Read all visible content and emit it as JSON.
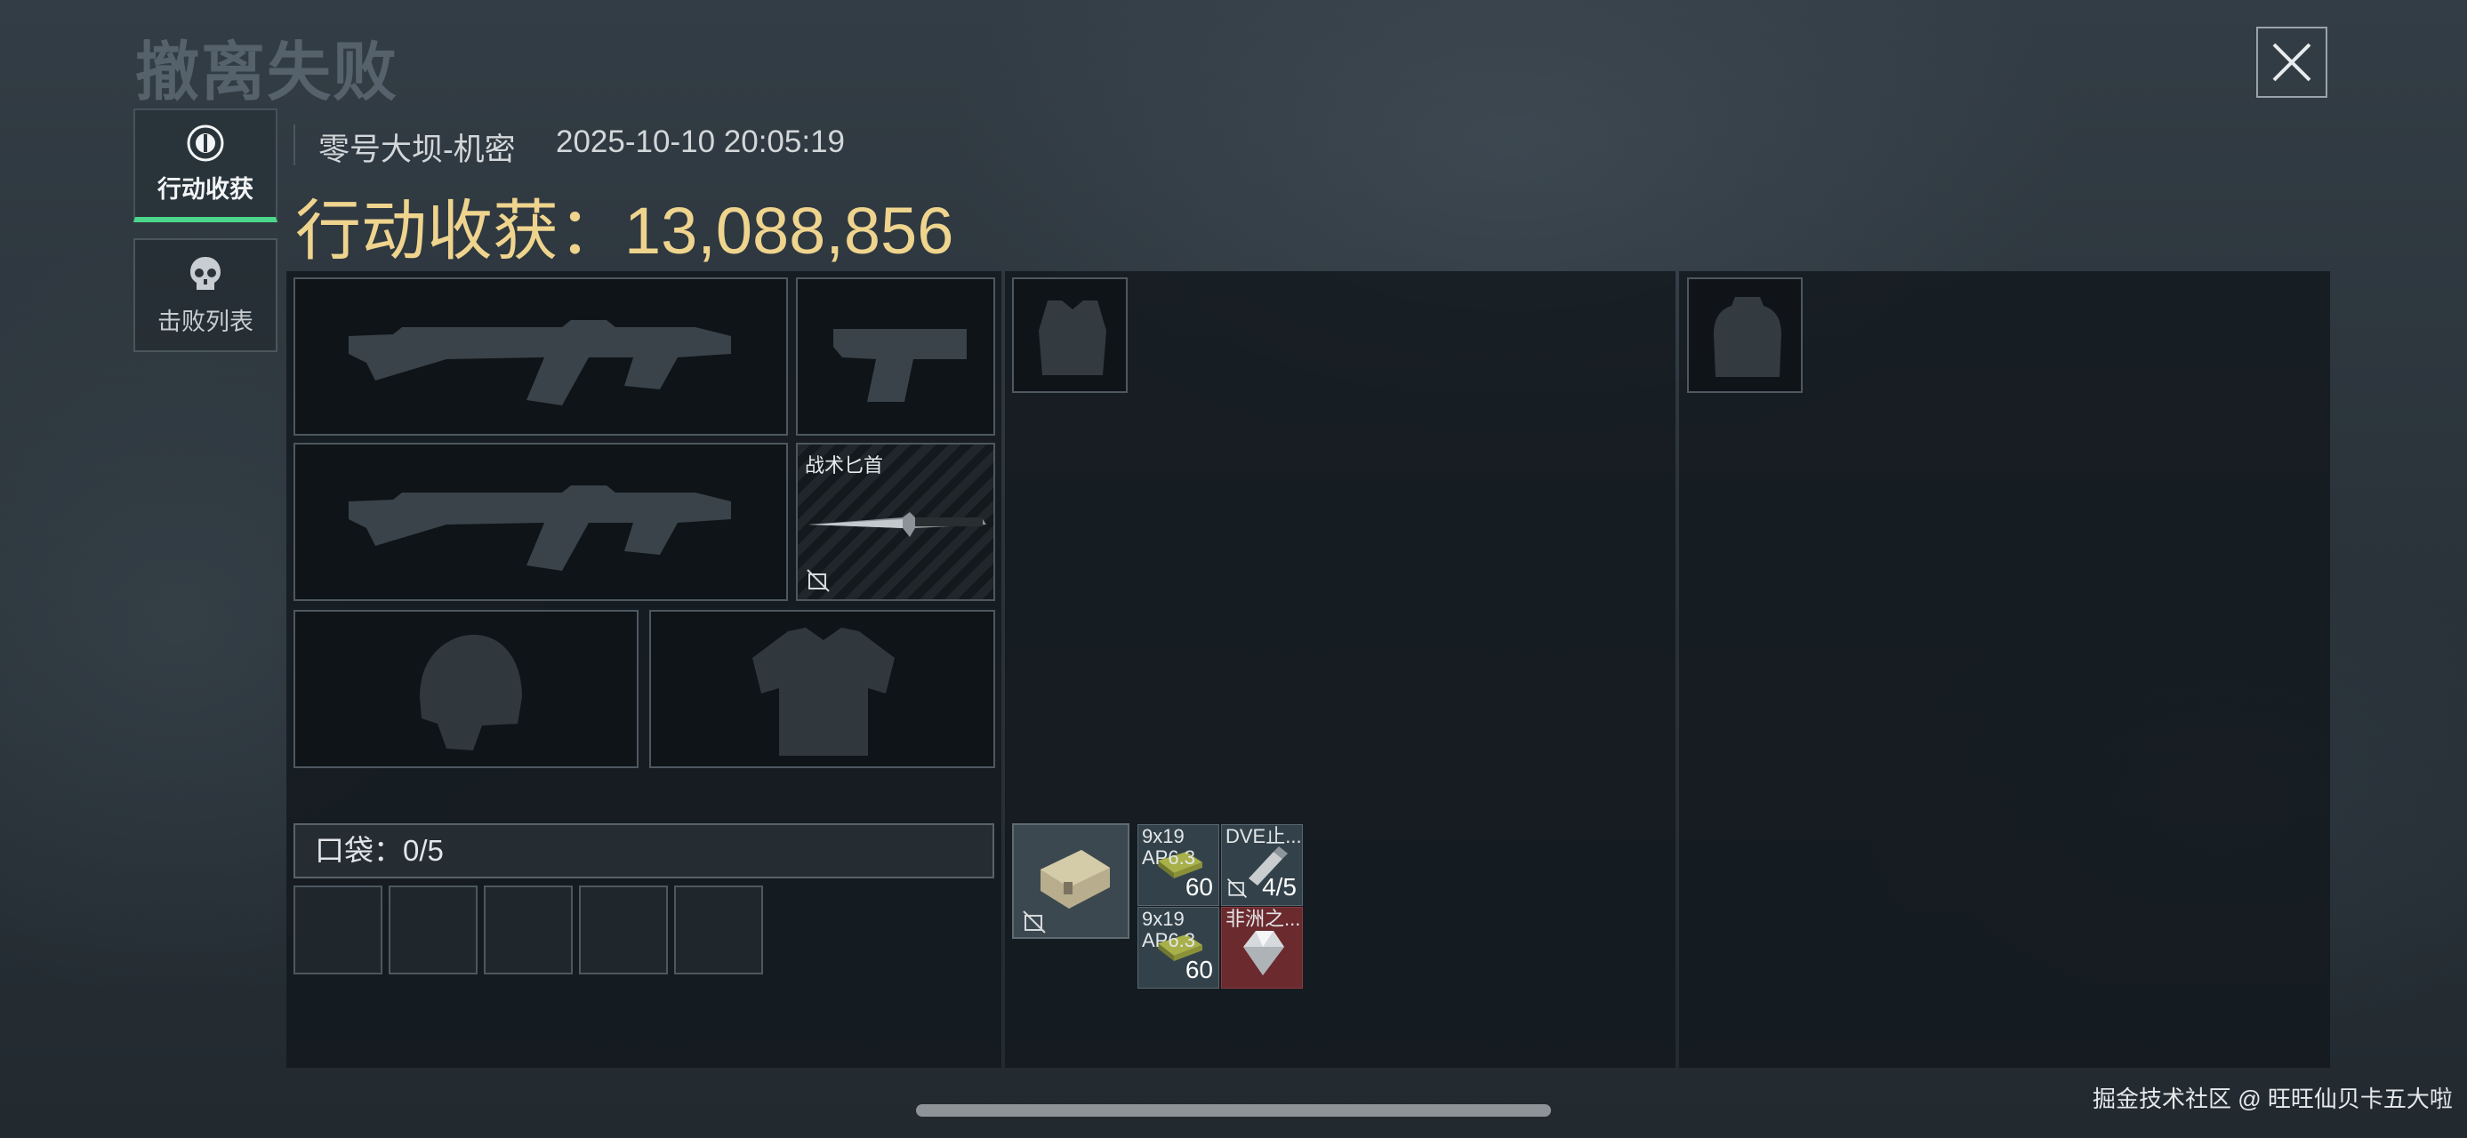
{
  "header": {
    "title": "撤离失败",
    "map": "零号大坝-机密",
    "datetime": "2025-10-10 20:05:19",
    "loot_label": "行动收获：",
    "loot_value": "13,088,856"
  },
  "tabs": [
    {
      "label": "行动收获",
      "icon": "operation-icon",
      "active": true
    },
    {
      "label": "击败列表",
      "icon": "skull-icon",
      "active": false
    }
  ],
  "equipment": {
    "melee_label": "战术匕首"
  },
  "pocket": {
    "label": "口袋：0/5"
  },
  "items": [
    {
      "name": "9x19",
      "sub": "AP6.3",
      "count": "60"
    },
    {
      "name": "DVE止...",
      "count": "4/5"
    },
    {
      "name": "9x19",
      "sub": "AP6.3",
      "count": "60"
    },
    {
      "name": "非洲之..."
    }
  ],
  "footer": {
    "watermark": "掘金技术社区 @ 旺旺仙贝卡五大啦"
  },
  "colors": {
    "accent_green": "#4cd68c",
    "loot_gold": "#efd48e",
    "rare_red": "#6a2a2e"
  }
}
